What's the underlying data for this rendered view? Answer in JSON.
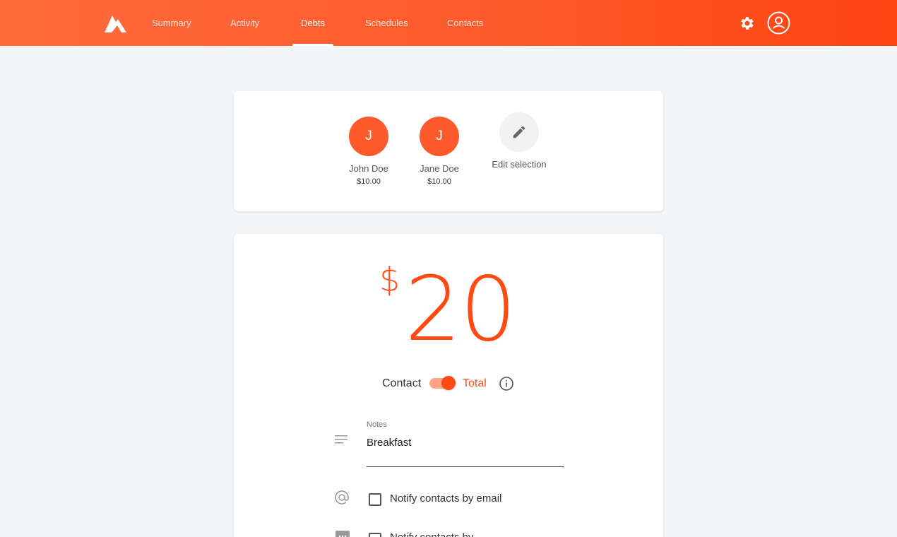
{
  "header": {
    "nav": [
      {
        "label": "Summary",
        "active": false
      },
      {
        "label": "Activity",
        "active": false
      },
      {
        "label": "Debts",
        "active": true
      },
      {
        "label": "Schedules",
        "active": false
      },
      {
        "label": "Contacts",
        "active": false
      }
    ],
    "icons": {
      "logo": "mountain-logo",
      "settings": "gear-icon",
      "account": "account-circle-icon"
    }
  },
  "selection": {
    "contacts": [
      {
        "initial": "J",
        "name": "John Doe",
        "amount": "$10.00"
      },
      {
        "initial": "J",
        "name": "Jane Doe",
        "amount": "$10.00"
      }
    ],
    "edit_label": "Edit selection"
  },
  "debt": {
    "currency_symbol": "$",
    "amount": "20",
    "toggle": {
      "left_label": "Contact",
      "right_label": "Total",
      "state": "Total"
    },
    "notes": {
      "label": "Notes",
      "value": "Breakfast"
    },
    "notify_email": {
      "label": "Notify contacts by email",
      "checked": false
    },
    "notify_sms": {
      "label": "Notify contacts by",
      "checked": false
    }
  },
  "colors": {
    "accent": "#ff4a14",
    "header_start": "#ff6a3c",
    "header_end": "#ff4410",
    "background": "#f3f6f8"
  }
}
